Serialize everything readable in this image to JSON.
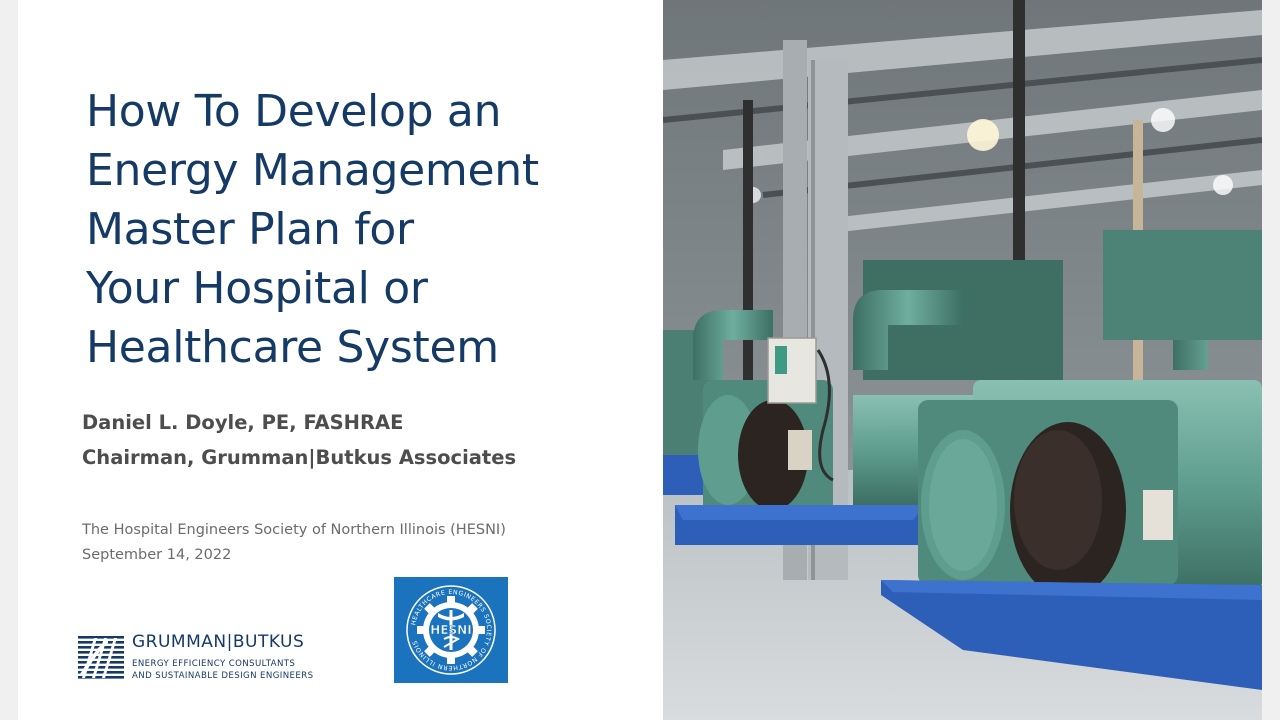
{
  "slide": {
    "title_lines": [
      "How To Develop an",
      "Energy Management",
      "Master Plan for",
      "Your Hospital or",
      "Healthcare System"
    ],
    "author_name": "Daniel L. Doyle, PE, FASHRAE",
    "author_title": "Chairman, Grumman|Butkus Associates",
    "event_name": "The Hospital Engineers Society of Northern Illinois (HESNI)",
    "event_date": "September 14, 2022"
  },
  "logos": {
    "company_name": "GRUMMAN|BUTKUS",
    "company_tagline_1": "ENERGY EFFICIENCY CONSULTANTS",
    "company_tagline_2": "AND SUSTAINABLE DESIGN ENGINEERS",
    "hesni_ring_text": "HEALTHCARE ENGINEERS SOCIETY OF NORTHERN ILLINOIS",
    "hesni_center_text": "HESNI"
  },
  "colors": {
    "title_blue": "#153a66",
    "hesni_blue": "#1b73bd",
    "chiller_green": "#5f9e8f",
    "floor_blue": "#2e5fb8"
  }
}
